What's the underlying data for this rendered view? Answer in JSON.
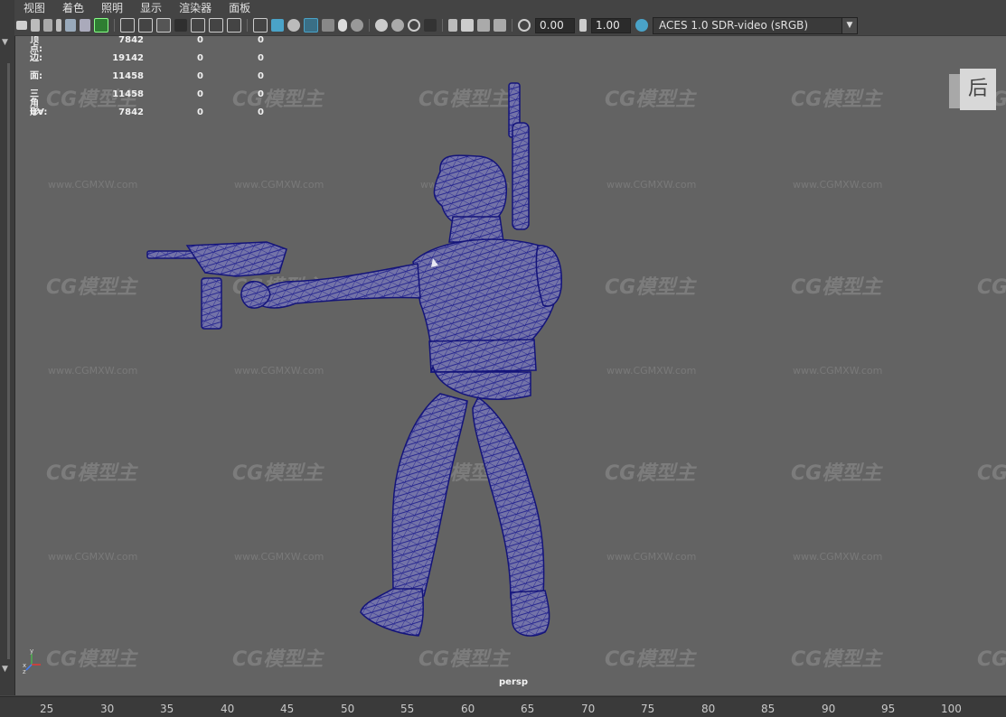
{
  "menu": [
    "视图",
    "着色",
    "照明",
    "显示",
    "渲染器",
    "面板"
  ],
  "toolbar": {
    "exposure_value": "0.00",
    "gamma_value": "1.00",
    "color_space": "ACES 1.0 SDR-video (sRGB)"
  },
  "hud": {
    "rows": [
      {
        "label": "顶点:",
        "v1": "7842",
        "v2": "0",
        "v3": "0"
      },
      {
        "label": "边:",
        "v1": "19142",
        "v2": "0",
        "v3": "0"
      },
      {
        "label": "面:",
        "v1": "11458",
        "v2": "0",
        "v3": "0"
      },
      {
        "label": "三角形:",
        "v1": "11458",
        "v2": "0",
        "v3": "0"
      },
      {
        "label": "UV:",
        "v1": "7842",
        "v2": "0",
        "v3": "0"
      }
    ]
  },
  "viewcube_label": "后",
  "camera_label": "persp",
  "axis": {
    "x": "x",
    "y": "y",
    "z": "z"
  },
  "watermark": {
    "logo": "CG模型主",
    "url": "www.CGMXW.com"
  },
  "timeline_ticks": [
    "25",
    "30",
    "35",
    "40",
    "45",
    "50",
    "55",
    "60",
    "65",
    "70",
    "75",
    "80",
    "85",
    "90",
    "95",
    "100"
  ],
  "colors": {
    "wireframe": "#1a1a8c",
    "viewport_bg": "#636363",
    "accent": "#4aa3c8"
  }
}
